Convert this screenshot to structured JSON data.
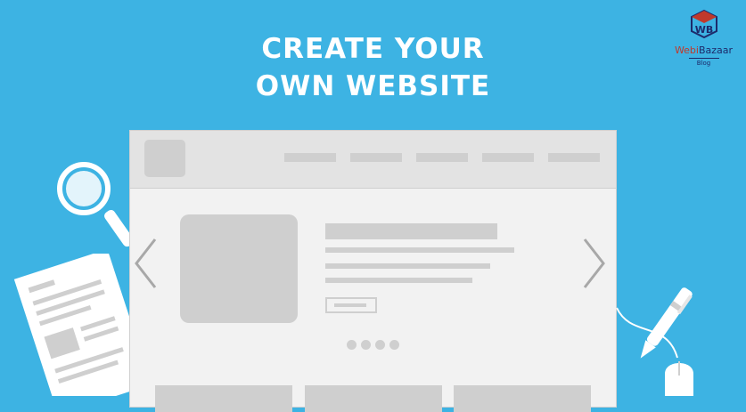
{
  "headline": {
    "line1": "CREATE YOUR",
    "line2": "OWN WEBSITE"
  },
  "brand": {
    "name_part1": "Webi",
    "name_part2": "Bazaar",
    "tagline": "Blog",
    "monogram": "WB"
  },
  "mockup": {
    "nav_item_count": 5,
    "carousel_dots": 4,
    "active_dot": 0,
    "footer_cards": 3
  },
  "icons": {
    "left": "chevron-left-icon",
    "right": "chevron-right-icon",
    "search": "magnifier-icon",
    "doc": "document-icon",
    "pen": "pen-icon",
    "mouse": "mouse-icon"
  },
  "colors": {
    "background": "#3db3e3",
    "placeholder": "#cfcfcf",
    "window": "#f2f2f2",
    "header": "#e3e3e3",
    "brand_navy": "#1d2a6b",
    "brand_red": "#c0392b"
  }
}
